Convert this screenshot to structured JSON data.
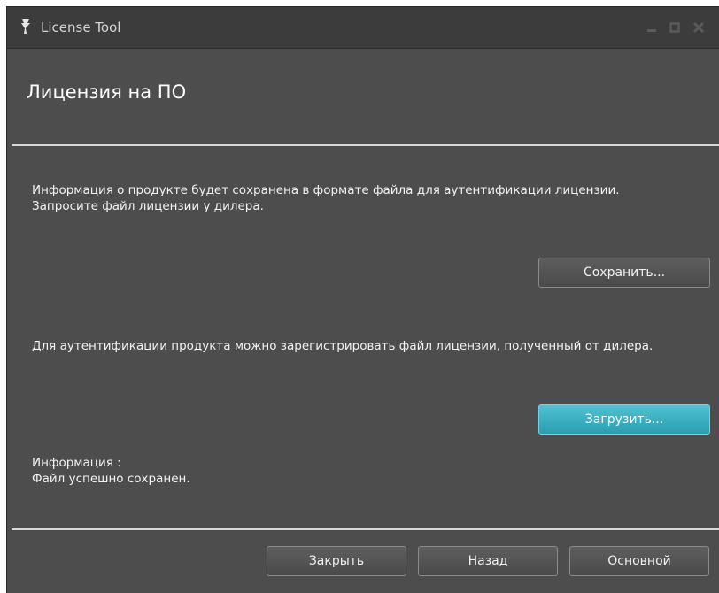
{
  "window": {
    "title": "License Tool",
    "icon": "license-app-icon",
    "controls": [
      "minimize-icon",
      "maximize-icon",
      "close-icon"
    ]
  },
  "header": {
    "title": "Лицензия на ПО"
  },
  "export_section": {
    "text": "Информация о продукте будет сохранена в формате файла для аутентификации лицензии. Запросите файл лицензии у дилера.",
    "button_label": "Сохранить..."
  },
  "import_section": {
    "text": "Для аутентификации продукта можно зарегистрировать файл лицензии, полученный от дилера.",
    "button_label": "Загрузить..."
  },
  "info": {
    "label": "Информация :",
    "value": "Файл успешно сохранен."
  },
  "footer": {
    "close_label": "Закрыть",
    "back_label": "Назад",
    "main_label": "Основной"
  },
  "colors": {
    "window_bg": "#4d4d4d",
    "titlebar_bg": "#3c3c3c",
    "accent": "#2a9fb2"
  }
}
